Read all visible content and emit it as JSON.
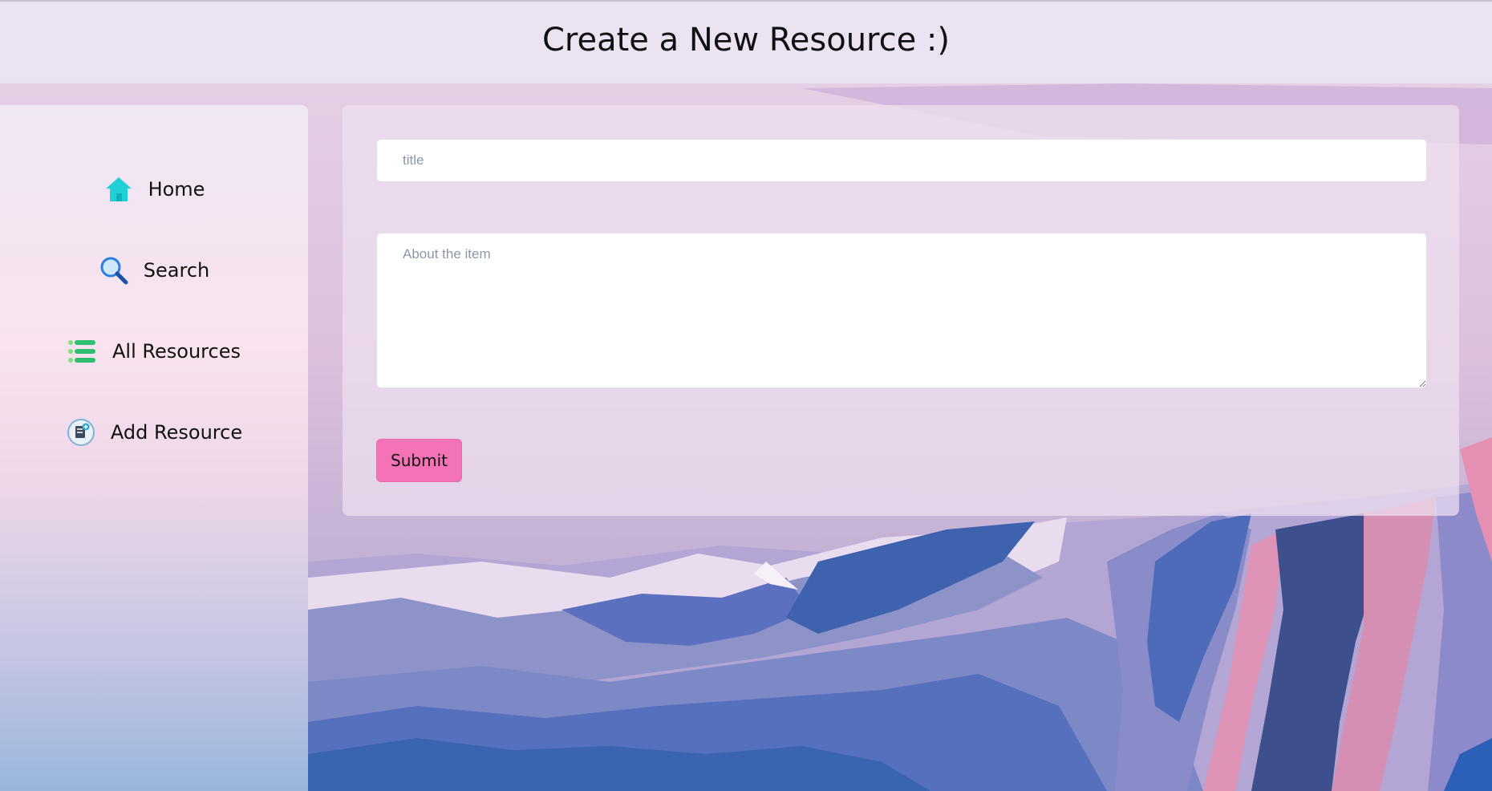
{
  "header": {
    "title": "Create a New Resource :)"
  },
  "sidebar": {
    "items": [
      {
        "label": "Home",
        "icon": "home-icon"
      },
      {
        "label": "Search",
        "icon": "search-icon"
      },
      {
        "label": "All Resources",
        "icon": "list-icon"
      },
      {
        "label": "Add Resource",
        "icon": "add-document-icon"
      }
    ]
  },
  "form": {
    "title_placeholder": "title",
    "title_value": "",
    "about_placeholder": "About the item",
    "about_value": "",
    "submit_label": "Submit"
  },
  "colors": {
    "accent": "#f472b6",
    "home_icon": "#1fd1d6",
    "list_icon": "#2fbf71"
  }
}
